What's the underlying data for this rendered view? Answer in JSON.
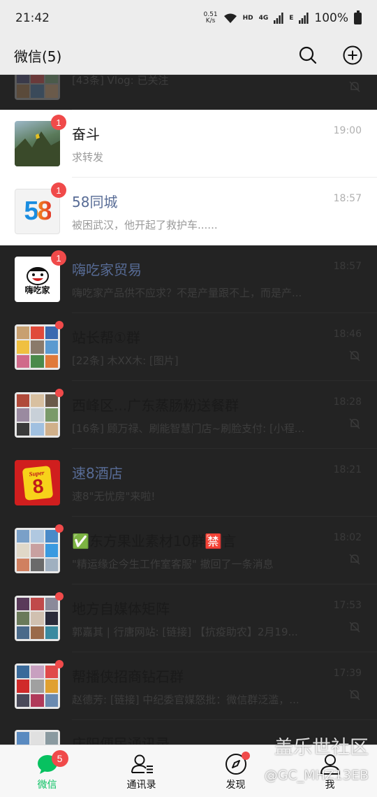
{
  "status_bar": {
    "time": "21:42",
    "net_speed_value": "0.51",
    "net_speed_unit": "K/s",
    "hd_label": "HD",
    "net_4g": "4G",
    "net_e": "E",
    "battery": "100%"
  },
  "header": {
    "title": "微信(5)",
    "search_icon": "search-icon",
    "add_icon": "plus-circle-icon"
  },
  "chats": [
    {
      "name": "",
      "message": "[43条] Vlog: 已关注",
      "time": "",
      "muted": true
    },
    {
      "name": "奋斗",
      "message": "求转发",
      "time": "19:00",
      "badge": "1"
    },
    {
      "name": "58同城",
      "message": "被困武汉，他开起了救护车......",
      "time": "18:57",
      "badge": "1"
    },
    {
      "name": "嗨吃家贸易",
      "message": "嗨吃家产品供不应求？不是产量跟不上，而是产...",
      "time": "18:57",
      "badge": "1"
    },
    {
      "name": "站长帮①群",
      "message": "[22条] 木XX木: [图片]",
      "time": "18:46",
      "muted": true
    },
    {
      "name": "西峰区...广东蒸肠粉送餐群",
      "message": "[16条] 顾万禄、刷能智慧门店~刷脸支付: [小程...",
      "time": "18:28",
      "muted": true
    },
    {
      "name": "速8酒店",
      "message": "速8\"无忧房\"来啦!",
      "time": "18:21"
    },
    {
      "name": "✅东方果业素材10群🈲言",
      "message": "\"精运缘企今生工作室客服\" 撤回了一条消息",
      "time": "18:02",
      "muted": true
    },
    {
      "name": "地方自媒体矩阵",
      "message": "郭嘉其 | 行唐网站: [链接] 【抗疫助农】2月19...",
      "time": "17:53",
      "muted": true
    },
    {
      "name": "帮播侠招商钻石群",
      "message": "赵德芳: [链接] 中纪委官媒怒批：微信群泛滥，...",
      "time": "17:39",
      "muted": true
    },
    {
      "name": "庆阳便民通讯录",
      "message": "",
      "time": ""
    }
  ],
  "avatar_text": {
    "logo_58": "58",
    "haichijia": "嗨吃家",
    "super8_top": "Super",
    "super8_num": "8"
  },
  "tabs": [
    {
      "label": "微信",
      "badge": "5"
    },
    {
      "label": "通讯录"
    },
    {
      "label": "发现"
    },
    {
      "label": "我"
    }
  ],
  "watermark": {
    "main": "盖乐世社区",
    "sub": "@GC_MHZ13EB"
  },
  "colors": {
    "wechat_green": "#07c160",
    "badge_red": "#f04a4a",
    "link_blue": "#576b95",
    "header_bg": "#ededed",
    "dim_overlay": "#232323"
  }
}
